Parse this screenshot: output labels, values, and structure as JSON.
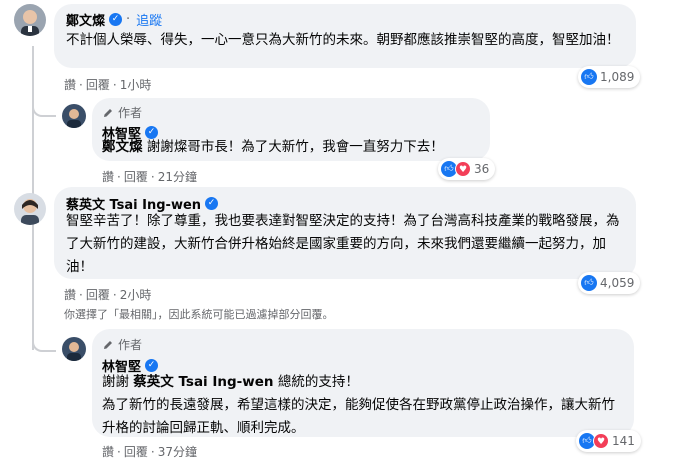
{
  "comments": [
    {
      "author": "鄭文燦",
      "follow_label": "追蹤",
      "text": "不計個人榮辱、得失，一心一意只為大新竹的未來。朝野都應該推崇智堅的高度，智堅加油！",
      "actions": {
        "like": "讚",
        "reply": "回覆",
        "time": "1小時"
      },
      "reaction_count": "1,089"
    },
    {
      "role": "作者",
      "author": "林智堅",
      "mention": "鄭文燦",
      "text": "謝謝燦哥市長！為了大新竹，我會一直努力下去！",
      "actions": {
        "like": "讚",
        "reply": "回覆",
        "time": "21分鐘"
      },
      "reaction_count": "36"
    },
    {
      "author": "蔡英文 Tsai Ing-wen",
      "text": "智堅辛苦了！除了尊重，我也要表達對智堅決定的支持！為了台灣高科技產業的戰略發展，為了大新竹的建設，大新竹合併升格始終是國家重要的方向，未來我們還要繼續一起努力，加油！",
      "actions": {
        "like": "讚",
        "reply": "回覆",
        "time": "2小時"
      },
      "reaction_count": "4,059",
      "filter_notice": "你選擇了「最相關」，因此系統可能已過濾掉部分回覆。"
    },
    {
      "role": "作者",
      "author": "林智堅",
      "line1_prefix": "謝謝 ",
      "mention": "蔡英文 Tsai Ing-wen",
      "line1_suffix": " 總統的支持！",
      "text": "為了新竹的長遠發展，希望這樣的決定，能夠促使各在野政黨停止政治操作，讓大新竹升格的討論回歸正軌、順利完成。",
      "actions": {
        "like": "讚",
        "reply": "回覆",
        "time": "37分鐘"
      },
      "reaction_count": "141"
    }
  ],
  "colors": {
    "accent": "#1877f2",
    "bubble": "#f0f2f5",
    "muted": "#65676b",
    "love": "#f33e58"
  },
  "icons": [
    "verified-icon",
    "like-icon",
    "love-icon",
    "pen-icon"
  ]
}
